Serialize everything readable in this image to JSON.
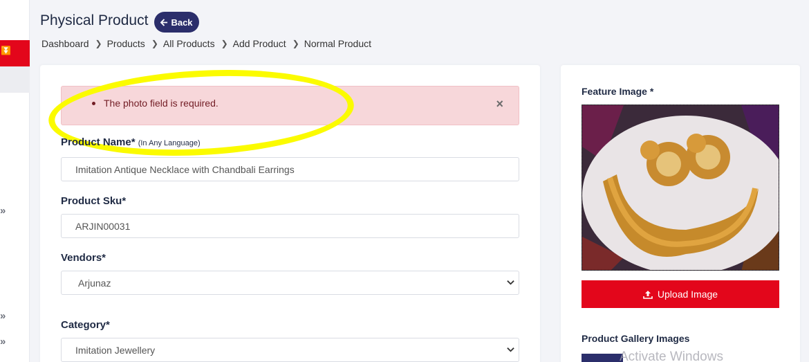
{
  "header": {
    "title": "Physical Product",
    "back_label": "Back"
  },
  "breadcrumb": [
    "Dashboard",
    "Products",
    "All Products",
    "Add Product",
    "Normal Product"
  ],
  "alert": {
    "message": "The photo field is required.",
    "close": "×"
  },
  "form": {
    "product_name_label": "Product Name*",
    "product_name_hint": "(In Any Language)",
    "product_name_value": "Imitation Antique Necklace with Chandbali Earrings",
    "sku_label": "Product Sku*",
    "sku_value": "ARJIN00031",
    "vendors_label": "Vendors*",
    "vendors_value": "Arjunaz",
    "category_label": "Category*",
    "category_value": "Imitation Jewellery"
  },
  "side": {
    "feature_label": "Feature Image *",
    "upload_label": "Upload Image",
    "gallery_label": "Product Gallery Images"
  },
  "watermark": "Activate Windows",
  "colors": {
    "accent_red": "#e3061b",
    "brand_navy": "#2b2e6b",
    "alert_bg": "#f7d7da",
    "highlight_yellow": "#fbfb00"
  }
}
